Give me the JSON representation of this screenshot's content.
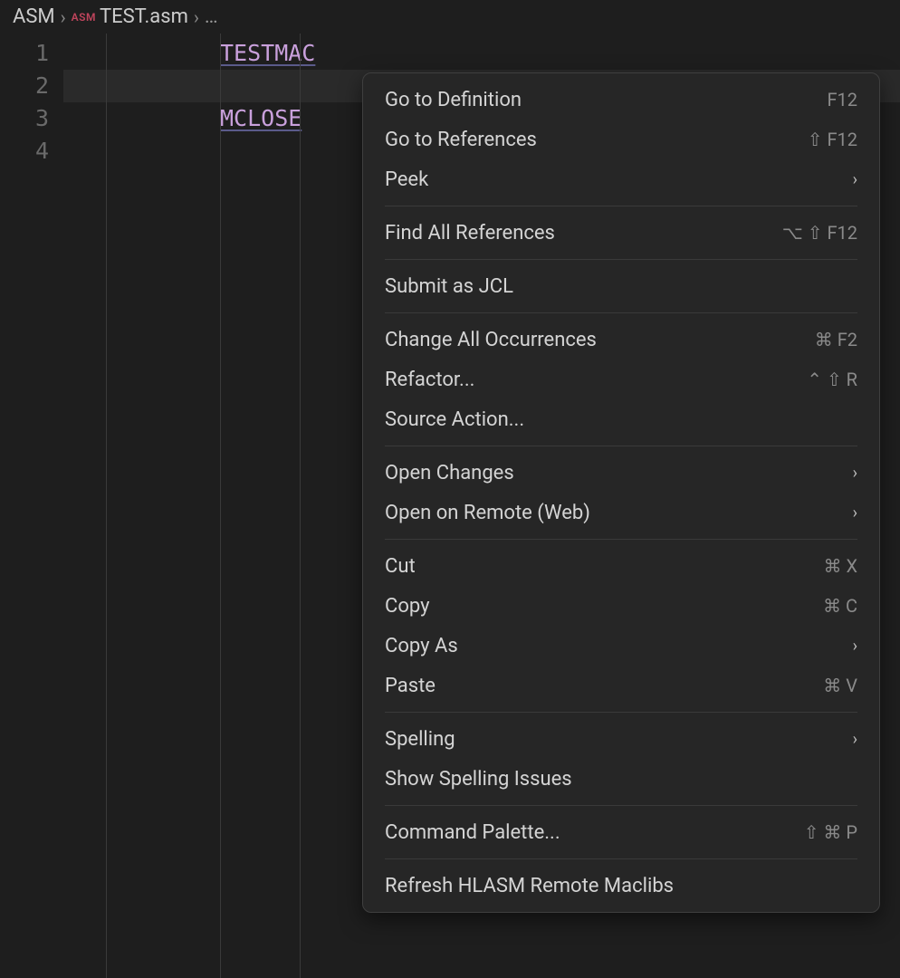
{
  "breadcrumb": {
    "root": "ASM",
    "lang_badge": "ASM",
    "filename": "TEST.asm",
    "more": "…"
  },
  "editor": {
    "line_numbers": [
      "1",
      "2",
      "3",
      "4"
    ],
    "tokens": {
      "line1": "TESTMAC",
      "line3": "MCLOSE"
    },
    "current_line_index": 1
  },
  "menu": {
    "groups": [
      [
        {
          "label": "Go to Definition",
          "shortcut": "F12",
          "submenu": false
        },
        {
          "label": "Go to References",
          "shortcut": "⇧ F12",
          "submenu": false
        },
        {
          "label": "Peek",
          "shortcut": "",
          "submenu": true
        }
      ],
      [
        {
          "label": "Find All References",
          "shortcut": "⌥ ⇧ F12",
          "submenu": false
        }
      ],
      [
        {
          "label": "Submit as JCL",
          "shortcut": "",
          "submenu": false
        }
      ],
      [
        {
          "label": "Change All Occurrences",
          "shortcut": "⌘ F2",
          "submenu": false
        },
        {
          "label": "Refactor...",
          "shortcut": "⌃ ⇧ R",
          "submenu": false
        },
        {
          "label": "Source Action...",
          "shortcut": "",
          "submenu": false
        }
      ],
      [
        {
          "label": "Open Changes",
          "shortcut": "",
          "submenu": true
        },
        {
          "label": "Open on Remote (Web)",
          "shortcut": "",
          "submenu": true
        }
      ],
      [
        {
          "label": "Cut",
          "shortcut": "⌘ X",
          "submenu": false
        },
        {
          "label": "Copy",
          "shortcut": "⌘ C",
          "submenu": false
        },
        {
          "label": "Copy As",
          "shortcut": "",
          "submenu": true
        },
        {
          "label": "Paste",
          "shortcut": "⌘ V",
          "submenu": false
        }
      ],
      [
        {
          "label": "Spelling",
          "shortcut": "",
          "submenu": true
        },
        {
          "label": "Show Spelling Issues",
          "shortcut": "",
          "submenu": false
        }
      ],
      [
        {
          "label": "Command Palette...",
          "shortcut": "⇧ ⌘ P",
          "submenu": false
        }
      ],
      [
        {
          "label": "Refresh HLASM Remote Maclibs",
          "shortcut": "",
          "submenu": false
        }
      ]
    ]
  }
}
